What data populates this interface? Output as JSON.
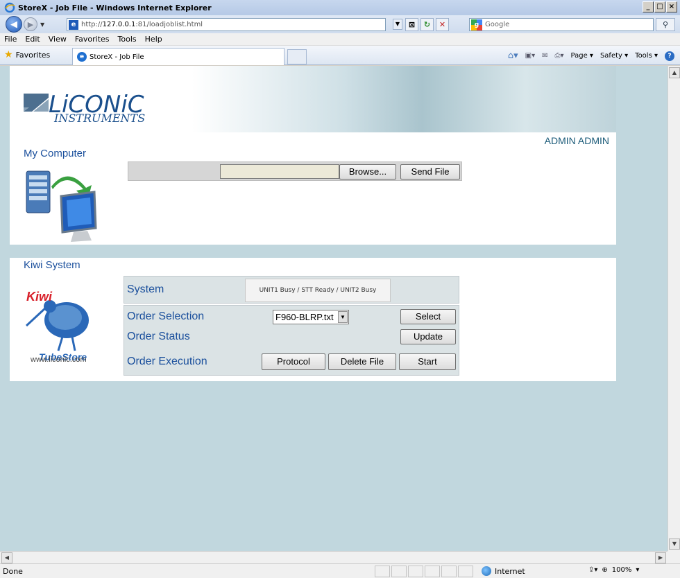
{
  "window": {
    "title": "StoreX - Job File - Windows Internet Explorer"
  },
  "address_bar": {
    "url_prefix": "http://",
    "url_host": "127.0.0.1",
    "url_rest": ":81/loadjoblist.html"
  },
  "search": {
    "placeholder": "Google"
  },
  "menu": {
    "items": [
      "File",
      "Edit",
      "View",
      "Favorites",
      "Tools",
      "Help"
    ]
  },
  "favorites_bar": {
    "favorites_label": "Favorites",
    "tab_title": "StoreX - Job File",
    "commands": [
      "Page",
      "Safety",
      "Tools"
    ]
  },
  "header": {
    "logo_main": "LiCONiC",
    "logo_sub": "INSTRUMENTS",
    "user": "ADMIN ADMIN"
  },
  "my_computer": {
    "title": "My Computer",
    "file_value": "",
    "browse_label": "Browse...",
    "send_label": "Send File"
  },
  "kiwi": {
    "title": "Kiwi System",
    "logo_kiwi": "Kiwi",
    "logo_tubestore": "TubeStore",
    "logo_url": "www.liconic.com",
    "system_label": "System",
    "system_status": "UNIT1 Busy / STT Ready / UNIT2 Busy",
    "order_selection_label": "Order Selection",
    "order_file": "F960-BLRP.txt",
    "select_label": "Select",
    "order_status_label": "Order Status",
    "update_label": "Update",
    "order_execution_label": "Order Execution",
    "protocol_label": "Protocol",
    "delete_label": "Delete File",
    "start_label": "Start"
  },
  "status_bar": {
    "status": "Done",
    "zone": "Internet",
    "zoom": "100%"
  },
  "colors": {
    "page_bg": "#c1d7de",
    "link_blue": "#1a4f9c",
    "panel_bg": "#dbe3e5"
  }
}
